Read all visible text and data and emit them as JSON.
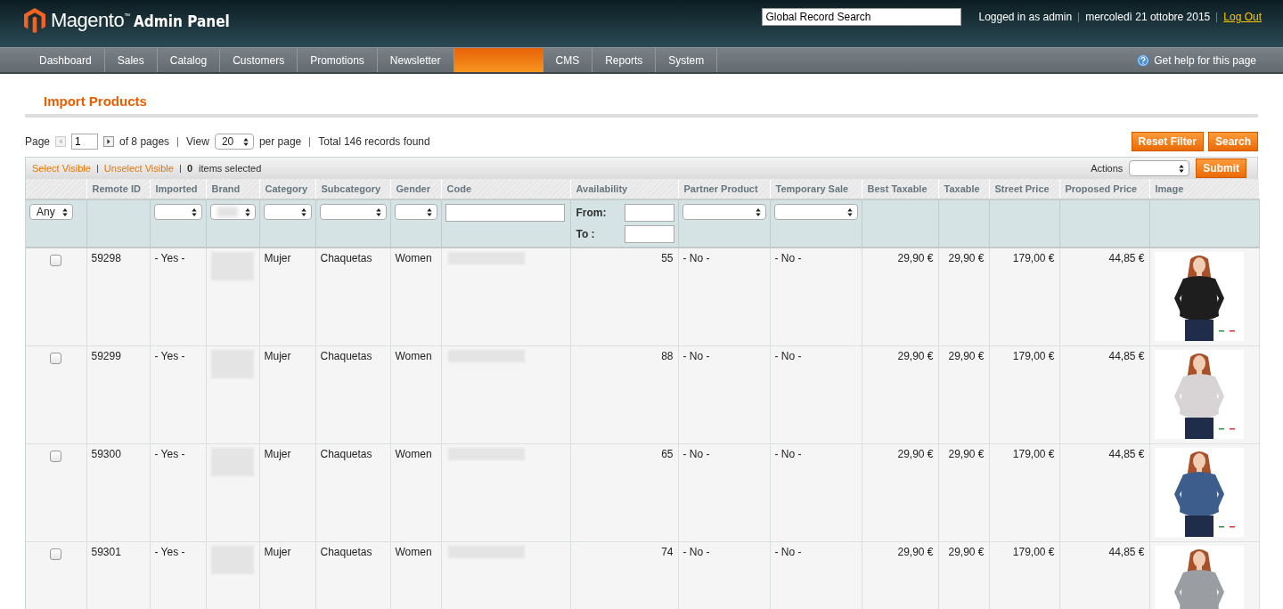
{
  "header": {
    "logo_text": "Magento$^{™}$",
    "logo_suffix": "Admin Panel",
    "search": {
      "value": "Global Record Search"
    },
    "user": "Logged in as admin",
    "date": "mercoledì 21 ottobre 2015",
    "logout": "Log Out"
  },
  "nav": {
    "items": [
      {
        "label": "Dashboard",
        "selected": false
      },
      {
        "label": "Sales",
        "selected": false
      },
      {
        "label": "Catalog",
        "selected": false
      },
      {
        "label": "Customers",
        "selected": false
      },
      {
        "label": "Promotions",
        "selected": false
      },
      {
        "label": "Newsletter",
        "selected": false
      },
      {
        "selected": true
      },
      {
        "label": "CMS",
        "selected": false
      },
      {
        "label": "Reports",
        "selected": false
      },
      {
        "label": "System",
        "selected": false
      }
    ],
    "help": "Get help for this page"
  },
  "page_title": "Import Products",
  "pager": {
    "page_label": "Page",
    "page": "1",
    "of_pages": "of 8 pages",
    "view_label": "View",
    "per_page": "20",
    "per_page_label": "per page",
    "total": "Total 146 records found",
    "prev_disabled": true
  },
  "buttons": [
    "Reset Filter",
    "Search"
  ],
  "massaction": {
    "select_visible": "Select Visible",
    "unselect_visible": "Unselect Visible",
    "count": "0",
    "count_label": "items selected",
    "actions_label": "Actions",
    "submit": "Submit"
  },
  "columns": [
    {
      "filter": {
        "kind": "select",
        "value": "Any"
      }
    },
    {
      "label": "Remote ID",
      "filter": {
        "kind": "none"
      }
    },
    {
      "label": "Imported",
      "filter": {
        "kind": "select"
      }
    },
    {
      "label": "Brand",
      "filter": {
        "kind": "select",
        "redacted": true
      }
    },
    {
      "label": "Category",
      "filter": {
        "kind": "select"
      }
    },
    {
      "label": "Subcategory",
      "filter": {
        "kind": "select"
      }
    },
    {
      "label": "Gender",
      "filter": {
        "kind": "select"
      }
    },
    {
      "label": "Code",
      "filter": {
        "kind": "text"
      }
    },
    {
      "label": "Availability",
      "filter": {
        "kind": "range",
        "from": "From:",
        "to": "To :"
      }
    },
    {
      "label": "Partner Product",
      "filter": {
        "kind": "select"
      }
    },
    {
      "label": "Temporary Sale",
      "filter": {
        "kind": "select"
      }
    },
    {
      "label": "Best Taxable",
      "filter": {
        "kind": "none"
      }
    },
    {
      "label": "Taxable",
      "filter": {
        "kind": "none"
      }
    },
    {
      "label": "Street Price",
      "filter": {
        "kind": "none"
      }
    },
    {
      "label": "Proposed Price",
      "filter": {
        "kind": "none"
      }
    },
    {
      "label": "Image",
      "filter": {
        "kind": "none"
      }
    }
  ],
  "rows": [
    {
      "checked": false,
      "cells": [
        {
          "kind": "checkbox"
        },
        {
          "kind": "text",
          "text": "59298"
        },
        {
          "kind": "text",
          "text": "- Yes -"
        },
        {
          "kind": "redacted"
        },
        {
          "kind": "text",
          "text": "Mujer"
        },
        {
          "kind": "text",
          "text": "Chaquetas"
        },
        {
          "kind": "text",
          "text": "Women"
        },
        {
          "kind": "redacted"
        },
        {
          "kind": "text",
          "text": "55"
        },
        {
          "kind": "text",
          "text": "- No -"
        },
        {
          "kind": "text",
          "text": "- No -"
        },
        {
          "kind": "text",
          "text": "29,90 €"
        },
        {
          "kind": "text",
          "text": "29,90 €"
        },
        {
          "kind": "text",
          "text": "179,00 €"
        },
        {
          "kind": "text",
          "text": "44,85 €"
        },
        {
          "kind": "picture"
        }
      ]
    },
    {
      "checked": false,
      "cells": [
        {
          "kind": "checkbox"
        },
        {
          "kind": "text",
          "text": "59299"
        },
        {
          "kind": "text",
          "text": "- Yes -"
        },
        {
          "kind": "redacted"
        },
        {
          "kind": "text",
          "text": "Mujer"
        },
        {
          "kind": "text",
          "text": "Chaquetas"
        },
        {
          "kind": "text",
          "text": "Women"
        },
        {
          "kind": "redacted"
        },
        {
          "kind": "text",
          "text": "88"
        },
        {
          "kind": "text",
          "text": "- No -"
        },
        {
          "kind": "text",
          "text": "- No -"
        },
        {
          "kind": "text",
          "text": "29,90 €"
        },
        {
          "kind": "text",
          "text": "29,90 €"
        },
        {
          "kind": "text",
          "text": "179,00 €"
        },
        {
          "kind": "text",
          "text": "44,85 €"
        },
        {
          "kind": "picture"
        }
      ]
    },
    {
      "checked": false,
      "cells": [
        {
          "kind": "checkbox"
        },
        {
          "kind": "text",
          "text": "59300"
        },
        {
          "kind": "text",
          "text": "- Yes -"
        },
        {
          "kind": "redacted"
        },
        {
          "kind": "text",
          "text": "Mujer"
        },
        {
          "kind": "text",
          "text": "Chaquetas"
        },
        {
          "kind": "text",
          "text": "Women"
        },
        {
          "kind": "redacted"
        },
        {
          "kind": "text",
          "text": "65"
        },
        {
          "kind": "text",
          "text": "- No -"
        },
        {
          "kind": "text",
          "text": "- No -"
        },
        {
          "kind": "text",
          "text": "29,90 €"
        },
        {
          "kind": "text",
          "text": "29,90 €"
        },
        {
          "kind": "text",
          "text": "179,00 €"
        },
        {
          "kind": "text",
          "text": "44,85 €"
        },
        {
          "kind": "picture"
        }
      ]
    },
    {
      "checked": false,
      "cells": [
        {
          "kind": "checkbox"
        },
        {
          "kind": "text",
          "text": "59301"
        },
        {
          "kind": "text",
          "text": "- Yes -"
        },
        {
          "kind": "redacted"
        },
        {
          "kind": "text",
          "text": "Mujer"
        },
        {
          "kind": "text",
          "text": "Chaquetas"
        },
        {
          "kind": "text",
          "text": "Women"
        },
        {
          "kind": "redacted"
        },
        {
          "kind": "text",
          "text": "74"
        },
        {
          "kind": "text",
          "text": "- No -"
        },
        {
          "kind": "text",
          "text": "- No -"
        },
        {
          "kind": "text",
          "text": "29,90 €"
        },
        {
          "kind": "text",
          "text": "29,90 €"
        },
        {
          "kind": "text",
          "text": "179,00 €"
        },
        {
          "kind": "text",
          "text": "44,85 €"
        },
        {
          "kind": "picture"
        }
      ]
    }
  ]
}
